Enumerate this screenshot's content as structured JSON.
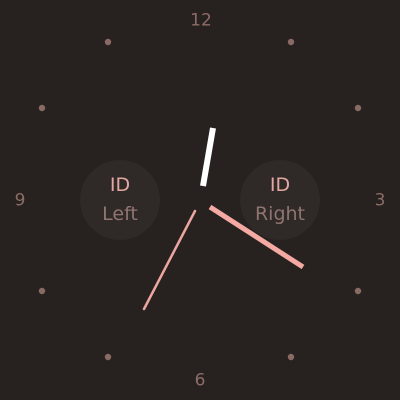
{
  "dial": {
    "numerals": {
      "twelve": "12",
      "three": "3",
      "six": "6",
      "nine": "9"
    }
  },
  "complications": {
    "left": {
      "id": "ID",
      "text": "Left"
    },
    "right": {
      "id": "ID",
      "text": "Right"
    }
  },
  "colors": {
    "background": "#272120",
    "numeral": "#8c6d66",
    "tick": "#8a6a64",
    "complication_bg": "#2f2a28",
    "complication_id": "#e3a8a2",
    "complication_text": "#8f7470",
    "hour_hand": "#ffffff",
    "minute_hand": "#f4a9a3",
    "second_hand": "#eba6a0"
  }
}
